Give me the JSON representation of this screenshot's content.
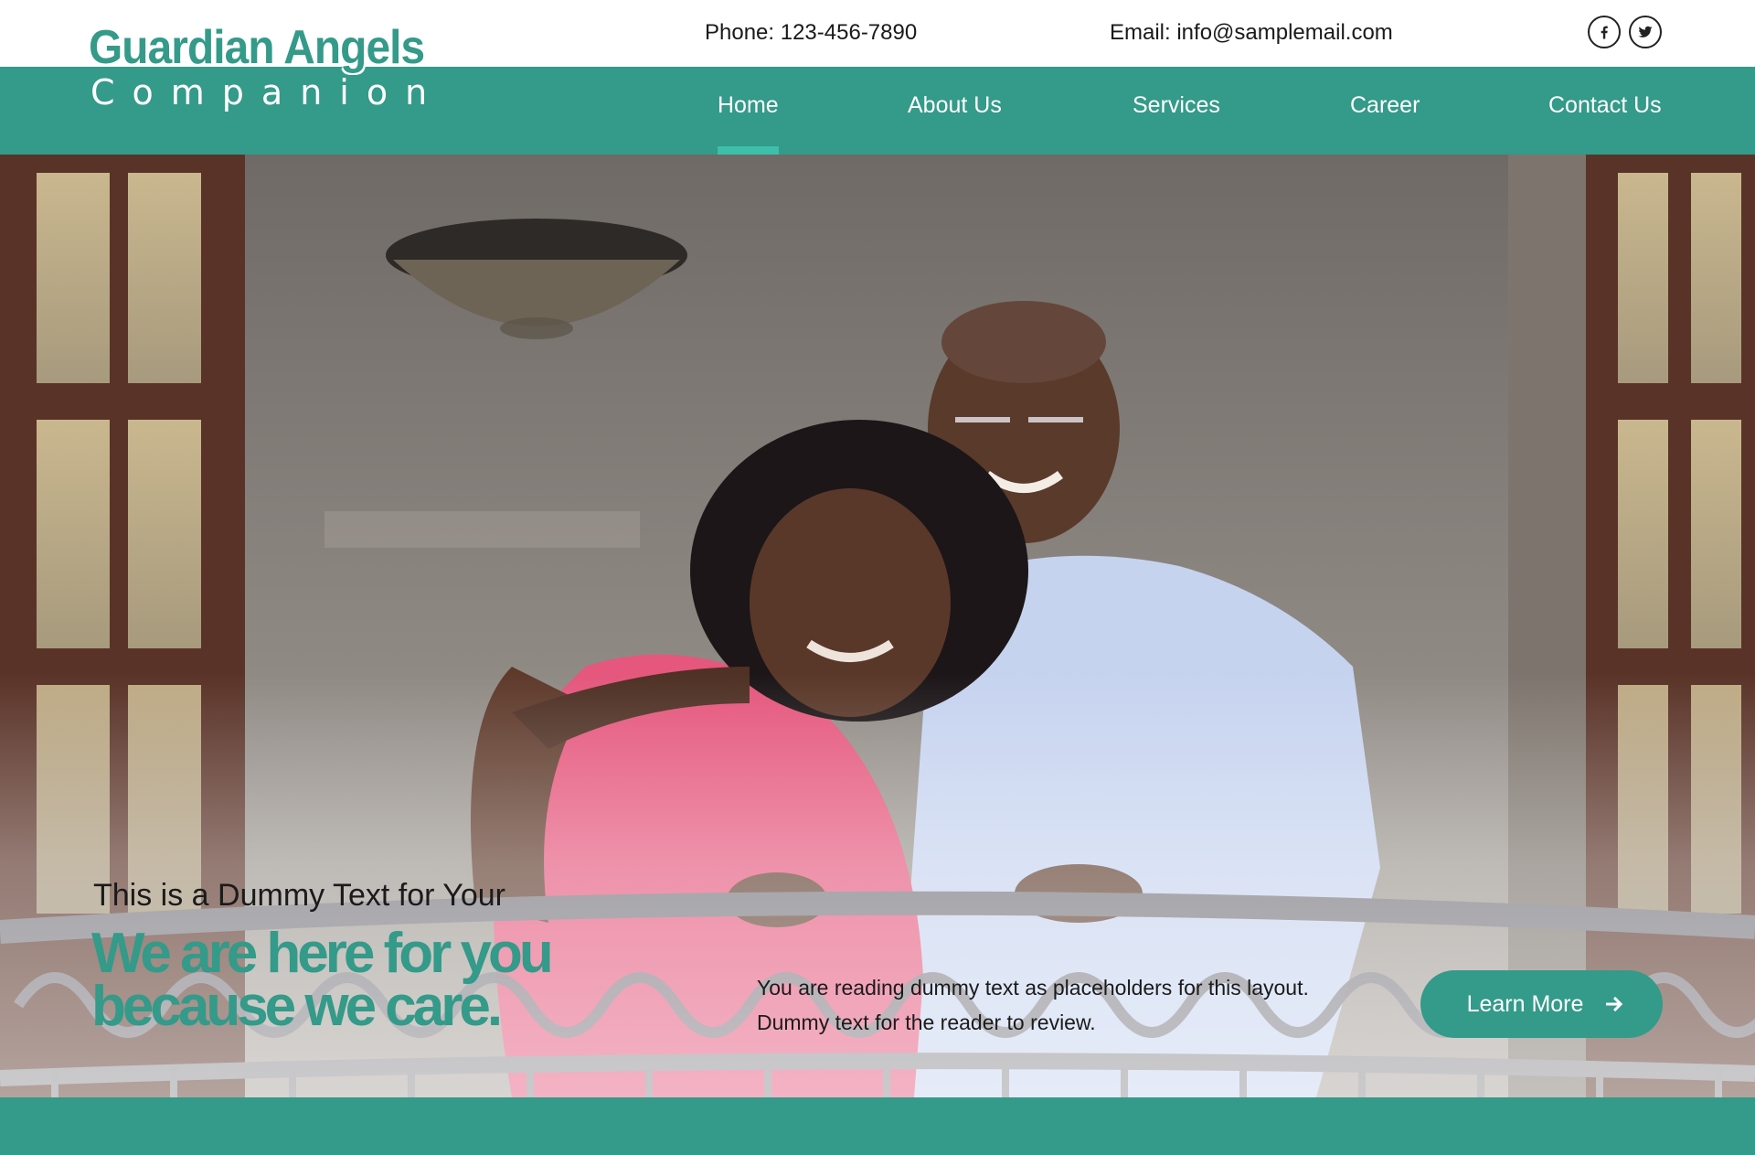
{
  "logo": {
    "line1": "Guardian Angels",
    "line2": "Companion"
  },
  "contact": {
    "phone": "Phone: 123-456-7890",
    "email": "Email: info@samplemail.com"
  },
  "social": [
    {
      "name": "facebook",
      "icon": "facebook-icon"
    },
    {
      "name": "twitter",
      "icon": "twitter-icon"
    }
  ],
  "nav": {
    "items": [
      {
        "label": "Home",
        "active": true
      },
      {
        "label": "About Us",
        "active": false
      },
      {
        "label": "Services",
        "active": false
      },
      {
        "label": "Career",
        "active": false
      },
      {
        "label": "Contact Us",
        "active": false
      }
    ]
  },
  "hero": {
    "image": "smiling elderly couple on balcony",
    "tagline": "This is a Dummy Text for Your",
    "headline_line1": "We are here for you",
    "headline_line2": "because we care.",
    "description_line1": "You are reading dummy text as placeholders for this layout.",
    "description_line2": "Dummy text for the reader to review.",
    "cta_label": "Learn More",
    "cta_icon": "arrow-right-icon"
  },
  "colors": {
    "brand": "#349a89",
    "active_indicator": "#3dbfab",
    "text": "#1b1b1b",
    "white": "#ffffff"
  }
}
